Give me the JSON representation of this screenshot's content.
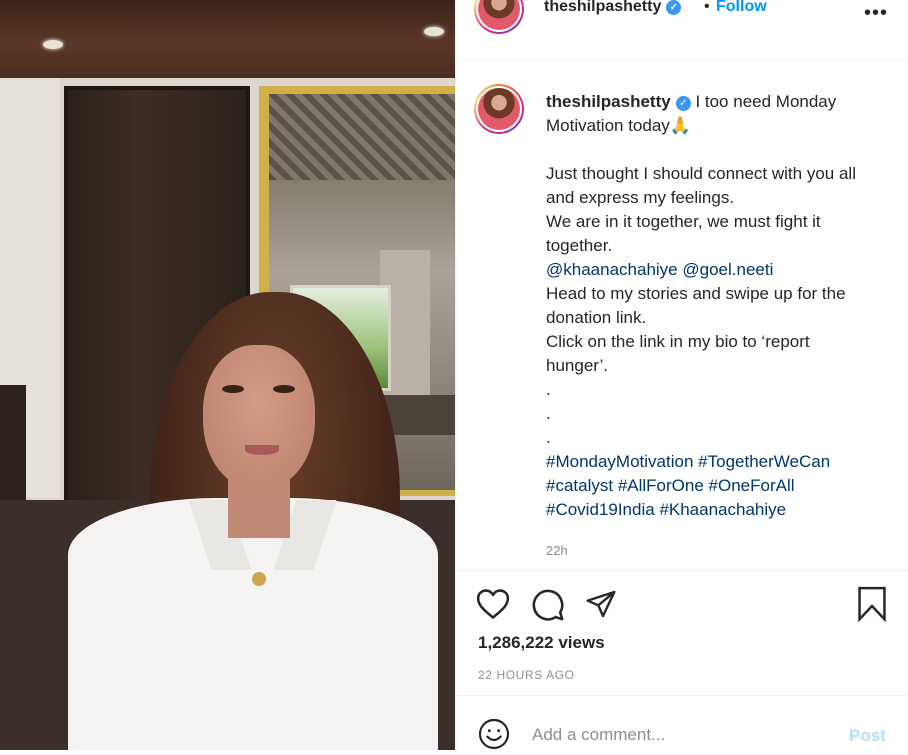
{
  "post": {
    "author": "theshilpashetty",
    "verified_icon": "verified-badge-icon",
    "follow_separator": "•",
    "follow_label": "Follow",
    "more_label": "•••"
  },
  "caption": {
    "author": "theshilpashetty",
    "first_line": "I too need Monday Motivation today🙏",
    "paragraph_1": "Just thought I should connect with you all and express my feelings.",
    "paragraph_2": "We are in it together, we must fight it together.",
    "mention_1": "@khaanachahiye",
    "mention_2": "@goel.neeti",
    "paragraph_3": "Head to my stories and swipe up for the donation link.",
    "paragraph_4": "Click on the link in my bio to ‘report hunger’.",
    "dot_1": ".",
    "dot_2": ".",
    "dot_3": ".",
    "hashtags": [
      "#MondayMotivation",
      "#TogetherWeCan",
      "#catalyst",
      "#AllForOne",
      "#OneForAll",
      "#Covid19India",
      "#Khaanachahiye"
    ],
    "relative_time": "22h"
  },
  "stats": {
    "views": "1,286,222 views",
    "posted": "22 HOURS AGO"
  },
  "comment": {
    "placeholder": "Add a comment...",
    "post_label": "Post"
  },
  "colors": {
    "link": "#00376b",
    "follow": "#0095f6",
    "post_disabled": "#b2dffc"
  }
}
